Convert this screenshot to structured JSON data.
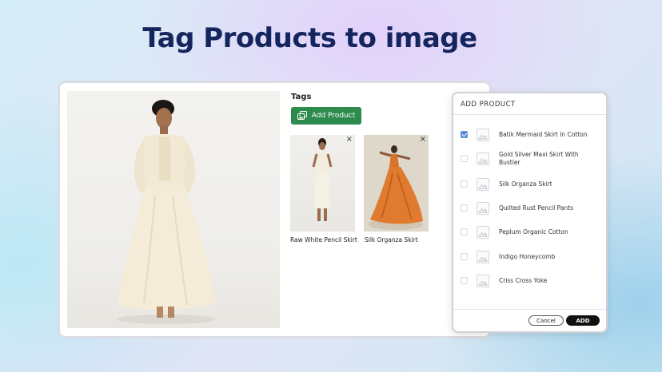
{
  "headline": "Tag Products to image",
  "tags_panel": {
    "title": "Tags",
    "add_button_label": "Add Product",
    "tagged": [
      {
        "label": "Raw White Pencil Skirt",
        "close": "×"
      },
      {
        "label": "Silk Organza Skirt",
        "close": "×"
      }
    ]
  },
  "modal": {
    "title": "ADD PRODUCT",
    "items": [
      {
        "label": "Batik Mermaid Skirt In Cotton",
        "checked": true
      },
      {
        "label": "Gold Silver Maxi Skirt With Bustier",
        "checked": false
      },
      {
        "label": "Silk Organza Skirt",
        "checked": false
      },
      {
        "label": "Quilted Rust Pencil Pants",
        "checked": false
      },
      {
        "label": "Peplum Organic Cotton",
        "checked": false
      },
      {
        "label": "Indigo Honeycomb",
        "checked": false
      },
      {
        "label": "Criss Cross Yoke",
        "checked": false
      }
    ],
    "cancel_label": "Cancel",
    "add_label": "ADD"
  },
  "colors": {
    "headline": "#15265f",
    "add_product_button": "#2e8b4e",
    "checkbox_checked": "#5a8fd8",
    "add_button": "#111111"
  },
  "icons": {
    "add_product": "images-icon",
    "item_thumbnail": "image-placeholder-icon",
    "remove_tag": "close-icon"
  }
}
